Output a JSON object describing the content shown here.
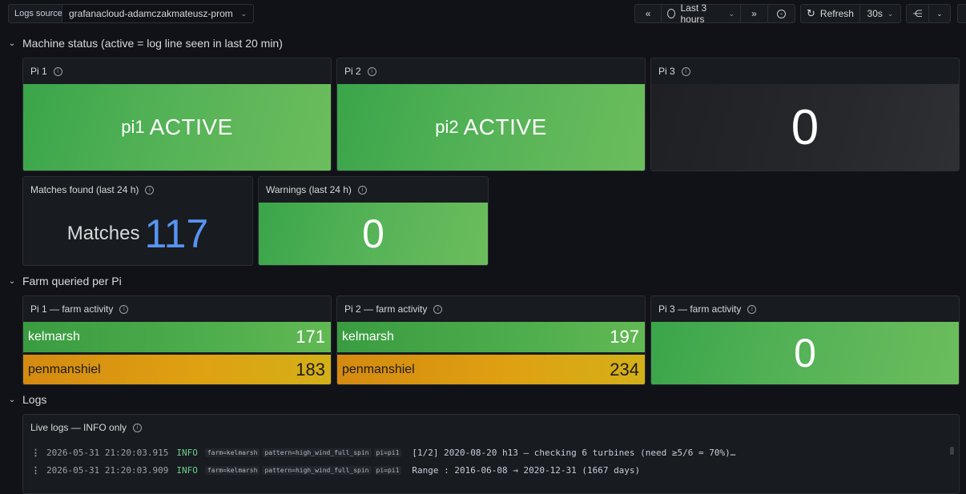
{
  "toolbar": {
    "logs_source_label": "Logs source",
    "logs_source_value": "grafanacloud-adamczakmateusz-prom",
    "time_range": "Last 3 hours",
    "refresh_label": "Refresh",
    "refresh_interval": "30s"
  },
  "rows": [
    {
      "title": "Machine status (active = log line seen in last 20 min)"
    },
    {
      "title": "Farm queried per Pi"
    },
    {
      "title": "Logs"
    }
  ],
  "machine_status": {
    "pi1": {
      "title": "Pi 1",
      "prefix": "pi1",
      "value": "ACTIVE"
    },
    "pi2": {
      "title": "Pi 2",
      "prefix": "pi2",
      "value": "ACTIVE"
    },
    "pi3": {
      "title": "Pi 3",
      "value": "0"
    },
    "matches": {
      "title": "Matches found (last 24 h)",
      "prefix": "Matches",
      "value": "117"
    },
    "warnings": {
      "title": "Warnings (last 24 h)",
      "value": "0"
    }
  },
  "farm_activity": {
    "pi1": {
      "title": "Pi 1 — farm activity",
      "rows": [
        {
          "label": "kelmarsh",
          "value": "171"
        },
        {
          "label": "penmanshiel",
          "value": "183"
        }
      ]
    },
    "pi2": {
      "title": "Pi 2 — farm activity",
      "rows": [
        {
          "label": "kelmarsh",
          "value": "197"
        },
        {
          "label": "penmanshiel",
          "value": "234"
        }
      ]
    },
    "pi3": {
      "title": "Pi 3 — farm activity",
      "value": "0"
    }
  },
  "logs": {
    "title": "Live logs — INFO only",
    "lines": [
      {
        "ts": "2026-05-31 21:20:03.915",
        "level": "INFO",
        "tags": [
          "farm=kelmarsh",
          "pattern=high_wind_full_spin",
          "pi=pi1"
        ],
        "msg": "[1/2]  2020-08-20 h13  — checking 6 turbines (need ≥5/6 = 70%)…"
      },
      {
        "ts": "2026-05-31 21:20:03.909",
        "level": "INFO",
        "tags": [
          "farm=kelmarsh",
          "pattern=high_wind_full_spin",
          "pi=pi1"
        ],
        "msg": "Range   : 2016-06-08 → 2020-12-31 (1667 days)"
      }
    ]
  },
  "colors": {
    "green": "#56b357",
    "orange": "#dfa012",
    "blue": "#5794f2",
    "bg": "#111217",
    "panel": "#181b1f"
  }
}
